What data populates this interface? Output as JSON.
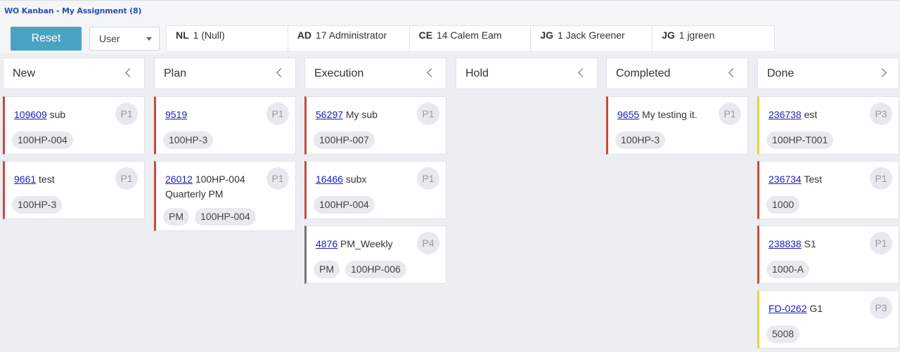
{
  "title": "WO Kanban - My Assignment (8)",
  "toolbar": {
    "reset_label": "Reset",
    "user_select_value": "User"
  },
  "assignees": [
    {
      "code": "NL",
      "label": "1 (Null)"
    },
    {
      "code": "AD",
      "label": "17 Administrator"
    },
    {
      "code": "CE",
      "label": "14 Calem Eam"
    },
    {
      "code": "JG",
      "label": "1 Jack Greener"
    },
    {
      "code": "JG",
      "label": "1 jgreen"
    }
  ],
  "columns": [
    {
      "title": "New",
      "chevron": "chevron-left-icon",
      "cards": [
        {
          "wo": "109609",
          "desc": "sub",
          "priority": "P1",
          "tags": [
            "100HP-004"
          ],
          "color": "#c94a3a"
        },
        {
          "wo": "9661",
          "desc": "test",
          "priority": "P1",
          "tags": [
            "100HP-3"
          ],
          "color": "#c94a3a"
        }
      ]
    },
    {
      "title": "Plan",
      "chevron": "chevron-left-icon",
      "cards": [
        {
          "wo": "9519",
          "desc": "",
          "priority": "P1",
          "tags": [
            "100HP-3"
          ],
          "color": "#c94a3a"
        },
        {
          "wo": "26012",
          "desc": "100HP-004 Quarterly PM",
          "priority": "P1",
          "tags": [
            "PM",
            "100HP-004"
          ],
          "color": "#c94a3a"
        }
      ]
    },
    {
      "title": "Execution",
      "chevron": "chevron-left-icon",
      "cards": [
        {
          "wo": "56297",
          "desc": "My sub",
          "priority": "P1",
          "tags": [
            "100HP-007"
          ],
          "color": "#c94a3a"
        },
        {
          "wo": "16466",
          "desc": "subx",
          "priority": "P1",
          "tags": [
            "100HP-004"
          ],
          "color": "#c94a3a"
        },
        {
          "wo": "4876",
          "desc": "PM_Weekly",
          "priority": "P4",
          "tags": [
            "PM",
            "100HP-006"
          ],
          "color": "#777777"
        }
      ]
    },
    {
      "title": "Hold",
      "chevron": "chevron-left-icon",
      "cards": []
    },
    {
      "title": "Completed",
      "chevron": "chevron-left-icon",
      "cards": [
        {
          "wo": "9655",
          "desc": "My testing it.",
          "priority": "P1",
          "tags": [
            "100HP-3"
          ],
          "color": "#c94a3a"
        }
      ]
    },
    {
      "title": "Done",
      "chevron": "chevron-right-icon",
      "cards": [
        {
          "wo": "236738",
          "desc": "est",
          "priority": "P3",
          "tags": [
            "100HP-T001"
          ],
          "color": "#e1d33a"
        },
        {
          "wo": "236734",
          "desc": "Test",
          "priority": "P1",
          "tags": [
            "1000"
          ],
          "color": "#c94a3a"
        },
        {
          "wo": "238838",
          "desc": "S1",
          "priority": "P1",
          "tags": [
            "1000-A"
          ],
          "color": "#c94a3a"
        },
        {
          "wo": "FD-0262",
          "desc": "G1",
          "priority": "P3",
          "tags": [
            "5008"
          ],
          "color": "#e1d33a"
        }
      ]
    }
  ]
}
